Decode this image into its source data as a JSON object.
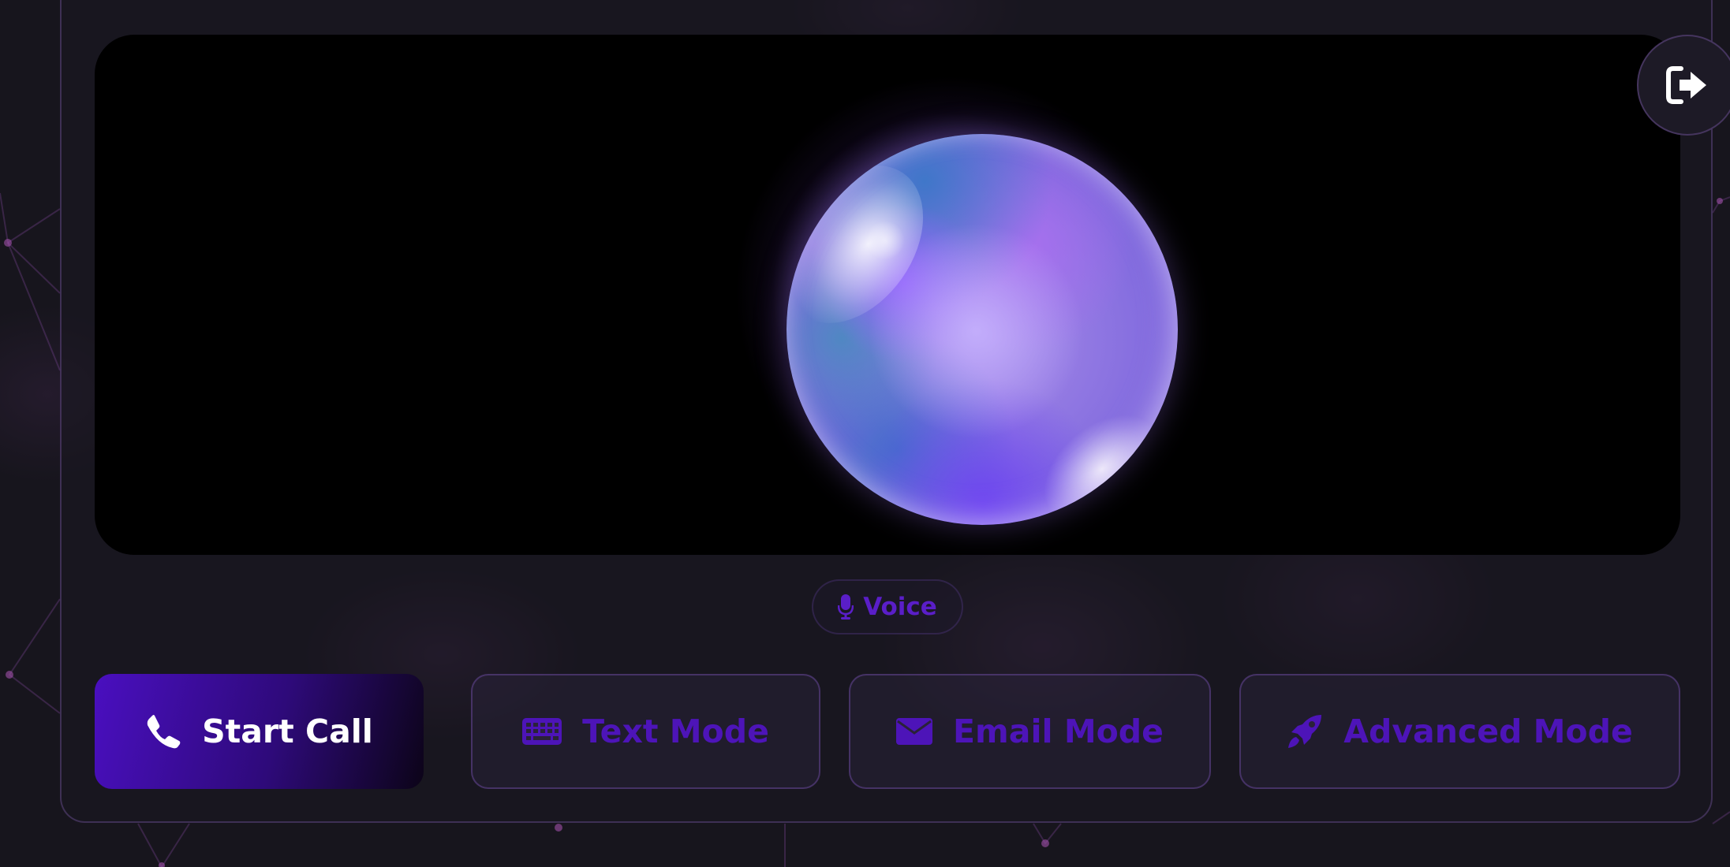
{
  "logout": {
    "icon": "logout-icon"
  },
  "stage": {
    "visual": "voice-orb"
  },
  "mode_indicator": {
    "icon": "microphone-icon",
    "label": "Voice"
  },
  "actions": {
    "start_call": {
      "icon": "phone-icon",
      "label": "Start Call"
    },
    "text_mode": {
      "icon": "keyboard-icon",
      "label": "Text Mode"
    },
    "email_mode": {
      "icon": "envelope-icon",
      "label": "Email Mode"
    },
    "advanced_mode": {
      "icon": "rocket-icon",
      "label": "Advanced Mode"
    }
  },
  "colors": {
    "primary_button_start": "#4a0fc0",
    "primary_button_end": "#0c0418",
    "ghost_button_text": "#4d14b8",
    "background": "#17151d"
  }
}
